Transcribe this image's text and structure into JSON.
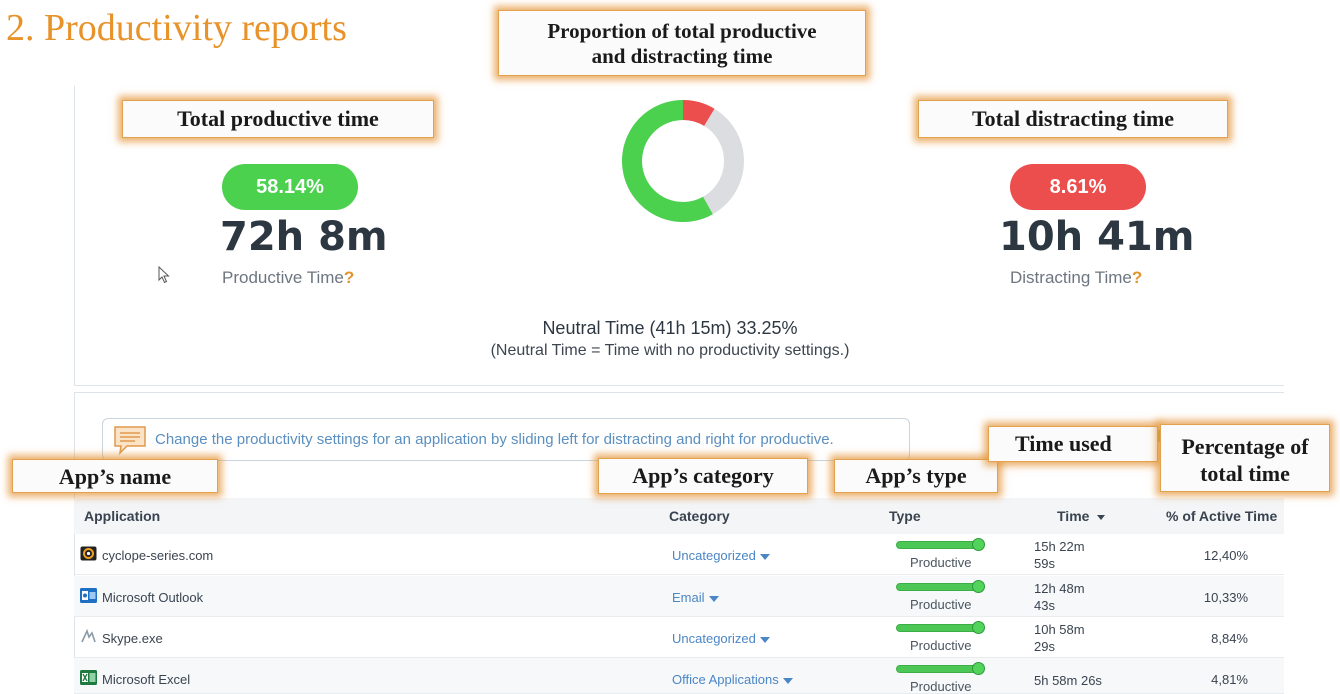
{
  "slide_title": "2. Productivity reports",
  "callouts": {
    "proportion_line1": "Proportion of total productive",
    "proportion_line2": "and distracting time",
    "total_productive": "Total productive time",
    "total_distracting": "Total distracting time",
    "app_name": "App’s name",
    "app_category": "App’s category",
    "app_type": "App’s type",
    "time_used": "Time used",
    "percentage_line1": "Percentage of",
    "percentage_line2": "total time"
  },
  "summary": {
    "productive_percent": "58.14%",
    "productive_time": "72h 8m",
    "productive_label": "Productive Time",
    "distracting_percent": "8.61%",
    "distracting_time": "10h 41m",
    "distracting_label": "Distracting Time",
    "help_mark": "?",
    "neutral_main": "Neutral Time (41h 15m) 33.25%",
    "neutral_sub": "(Neutral Time = Time with no productivity settings.)"
  },
  "donut": {
    "productive_share": 0.5814,
    "distracting_share": 0.0861,
    "neutral_share": 0.3325,
    "colors": {
      "productive": "#4cd14f",
      "distracting": "#ec4d4d",
      "neutral": "#dcdde0"
    }
  },
  "hint": "Change the productivity settings for an application by sliding left for distracting and right for productive.",
  "table": {
    "headers": {
      "application": "Application",
      "category": "Category",
      "type": "Type",
      "time": "Time",
      "percent": "% of Active Time"
    },
    "rows": [
      {
        "app": "cyclope-series.com",
        "icon": "website-icon",
        "category": "Uncategorized",
        "type": "Productive",
        "time_line1": "15h 22m",
        "time_line2": "59s",
        "percent": "12,40%"
      },
      {
        "app": "Microsoft Outlook",
        "icon": "outlook-icon",
        "category": "Email",
        "type": "Productive",
        "time_line1": "12h 48m",
        "time_line2": "43s",
        "percent": "10,33%"
      },
      {
        "app": "Skype.exe",
        "icon": "skype-icon",
        "category": "Uncategorized",
        "type": "Productive",
        "time_line1": "10h 58m",
        "time_line2": "29s",
        "percent": "8,84%"
      },
      {
        "app": "Microsoft Excel",
        "icon": "excel-icon",
        "category": "Office Applications",
        "type": "Productive",
        "time_line1": "5h 58m 26s",
        "time_line2": "",
        "percent": "4,81%"
      }
    ]
  },
  "colors": {
    "productive": "#4cd14f",
    "distracting": "#ec4d4d",
    "accent_title": "#e8922a",
    "link": "#4b86c5"
  }
}
